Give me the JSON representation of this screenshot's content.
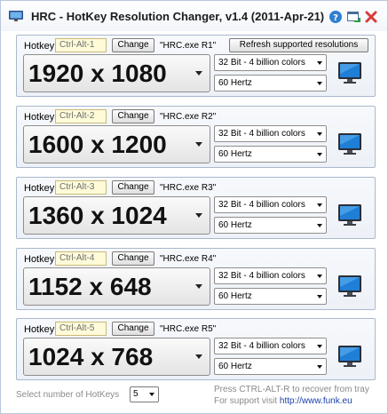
{
  "window": {
    "title": "HRC - HotKey Resolution Changer, v1.4 (2011-Apr-21)",
    "icons": [
      "app-monitor-icon",
      "help-icon",
      "restore-icon",
      "close-icon"
    ]
  },
  "panels": [
    {
      "hotkey_label": "Hotkey",
      "hotkey_value": "Ctrl-Alt-1",
      "change_label": "Change",
      "program": "\"HRC.exe R1\"",
      "resolution": "1920 x 1080",
      "color_depth": "32 Bit - 4 billion colors",
      "refresh_rate": "60 Hertz"
    },
    {
      "hotkey_label": "Hotkey",
      "hotkey_value": "Ctrl-Alt-2",
      "change_label": "Change",
      "program": "\"HRC.exe R2\"",
      "resolution": "1600 x 1200",
      "color_depth": "32 Bit - 4 billion colors",
      "refresh_rate": "60 Hertz"
    },
    {
      "hotkey_label": "Hotkey",
      "hotkey_value": "Ctrl-Alt-3",
      "change_label": "Change",
      "program": "\"HRC.exe R3\"",
      "resolution": "1360 x 1024",
      "color_depth": "32 Bit - 4 billion colors",
      "refresh_rate": "60 Hertz"
    },
    {
      "hotkey_label": "Hotkey",
      "hotkey_value": "Ctrl-Alt-4",
      "change_label": "Change",
      "program": "\"HRC.exe R4\"",
      "resolution": "1152 x 648",
      "color_depth": "32 Bit - 4 billion colors",
      "refresh_rate": "60 Hertz"
    },
    {
      "hotkey_label": "Hotkey",
      "hotkey_value": "Ctrl-Alt-5",
      "change_label": "Change",
      "program": "\"HRC.exe R5\"",
      "resolution": "1024 x 768",
      "color_depth": "32 Bit - 4 billion colors",
      "refresh_rate": "60 Hertz"
    }
  ],
  "refresh_button": "Refresh supported resolutions",
  "footer": {
    "select_label": "Select number of HotKeys",
    "hotkey_count": "5",
    "recover_text": "Press CTRL-ALT-R to recover from tray",
    "support_prefix": "For support visit",
    "support_url": "http://www.funk.eu"
  },
  "colors": {
    "panel_border": "#a9b8cc",
    "hotkey_field_bg": "#fffbd9",
    "link": "#1a3fa8",
    "close_red": "#d83b3b",
    "help_blue": "#2f7fd0"
  }
}
